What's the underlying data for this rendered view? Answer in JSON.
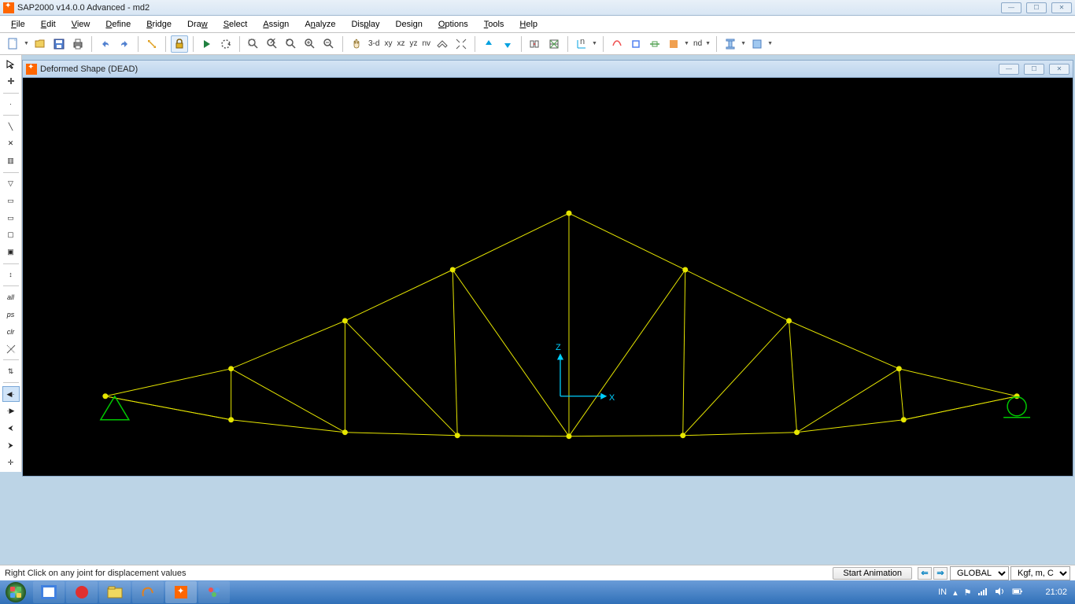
{
  "titlebar": {
    "title": "SAP2000 v14.0.0 Advanced  - md2"
  },
  "menu": {
    "items": [
      "File",
      "Edit",
      "View",
      "Define",
      "Bridge",
      "Draw",
      "Select",
      "Assign",
      "Analyze",
      "Display",
      "Design",
      "Options",
      "Tools",
      "Help"
    ]
  },
  "toolbar": {
    "view_labels": {
      "threed": "3-d",
      "xy": "xy",
      "xz": "xz",
      "yz": "yz",
      "nv": "nv",
      "nd": "nd"
    }
  },
  "left_toolbar": {
    "labels": {
      "all": "all",
      "ps": "ps",
      "clr": "clr"
    },
    "tooltip_chars": {
      "line": "\\",
      "x": "✕",
      "bars": "▥",
      "tri": "▽",
      "rect": "▭",
      "rect2": "▭",
      "box": "▢",
      "box2": "▣",
      "axis": "↕",
      "arrows": "⇅",
      "left": "◀",
      "right": "▶",
      "chev_l": "⮜",
      "chev_r": "⮞",
      "cross": "✛"
    }
  },
  "viewport": {
    "title": "Deformed Shape (DEAD)",
    "axis_z": "Z",
    "axis_x": "X"
  },
  "status": {
    "hint": "Right Click on any joint for displacement values",
    "start_anim": "Start Animation",
    "coord_sys": "GLOBAL",
    "units": "Kgf, m, C"
  },
  "taskbar": {
    "locale": "IN",
    "clock": "21:02"
  }
}
